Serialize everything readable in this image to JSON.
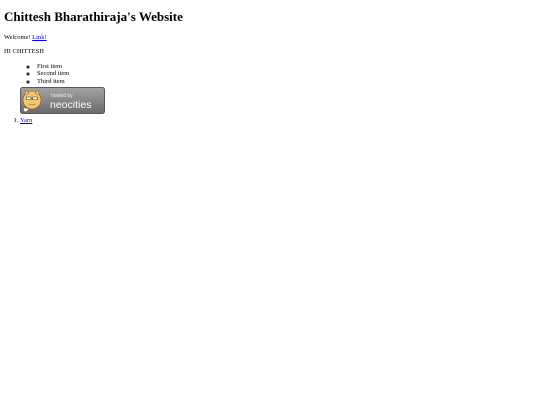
{
  "header": {
    "title": "Chittesh Bharathiraja's Website"
  },
  "welcome": {
    "text": "Welcome! ",
    "link_label": "Link!"
  },
  "greeting": "HI CHITTESH",
  "list": {
    "items": [
      "First item",
      "Second item",
      "Third item"
    ]
  },
  "badge": {
    "line1": "hosted by",
    "line2": "neocities",
    "colors": {
      "bg_top": "#9a9a9a",
      "bg_bottom": "#6f6f6f",
      "cat": "#f4c470"
    }
  },
  "ordered_list": {
    "items": [
      {
        "label": "Yarn"
      }
    ]
  },
  "colors": {
    "link": "#0000ee",
    "text": "#000000",
    "background": "#ffffff"
  }
}
